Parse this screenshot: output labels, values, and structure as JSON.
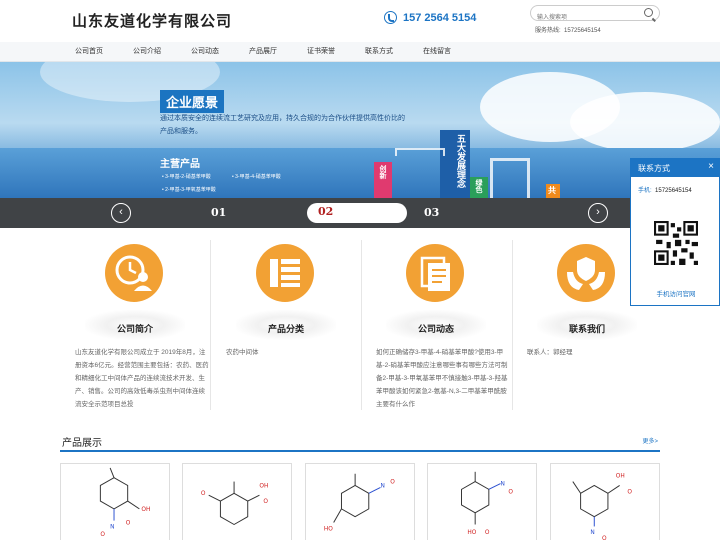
{
  "header": {
    "company": "山东友道化学有限公司",
    "phone": "157 2564 5154",
    "search_placeholder": "输入搜索项",
    "hotline_label": "服务热线:",
    "hotline_number": "15725645154"
  },
  "nav": [
    "公司首页",
    "公司介绍",
    "公司动态",
    "产品展厅",
    "证书荣誉",
    "联系方式",
    "在线留言"
  ],
  "banner": {
    "vision_title": "企业愿景",
    "vision_desc": "通过本质安全的连续流工艺研究及应用，持久合规的为合作伙伴提供高性价比的产品和服务。",
    "main_products_title": "主营产品",
    "products": [
      "3-甲基-2-硝基苯甲酸",
      "3-甲基-4-硝基苯甲酸",
      "2-甲基-3-甲氧基苯甲酸"
    ],
    "sign_text": "五大发展理念",
    "sign_left": "创新",
    "sign_mid": "绿色",
    "sign_right": "共"
  },
  "slider": {
    "prev": "‹",
    "next": "›",
    "slides": [
      "01",
      "02",
      "03"
    ],
    "active": "02"
  },
  "features": [
    {
      "title": "公司简介",
      "text": "山东友道化学有限公司成立于 2019年8月，注册资本6亿元。经营范围主要包括：农药、医药和精细化工中间体产品的连续流技术开发、生产、销售。公司的高效低毒杀虫剂中间体连续流安全示范项目总投"
    },
    {
      "title": "产品分类",
      "text": "农药中间体"
    },
    {
      "title": "公司动态",
      "text": "如何正确储存3-甲基-4-硝基苯甲酸?使用3-甲基-2-硝基苯甲酸应注意哪些事有哪些方法可制备2-甲基-3-甲氧基苯甲不慎接触3-甲基-3-羟基苯甲酸该如何紧急2-氨基-N,3-二甲基苯甲酰胺主要有什么作"
    },
    {
      "title": "联系我们",
      "text": "联系人：郭经理"
    }
  ],
  "products_section": {
    "title": "产品展示",
    "more": "更多>"
  },
  "float_contact": {
    "title": "联系方式",
    "close": "×",
    "mobile_label": "手机:",
    "mobile": "15725645154",
    "visit": "手机访问官网"
  },
  "colors": {
    "primary": "#1c74c4",
    "orange": "#f2a134",
    "slider_bg": "#404346",
    "active_num": "#b02020"
  }
}
